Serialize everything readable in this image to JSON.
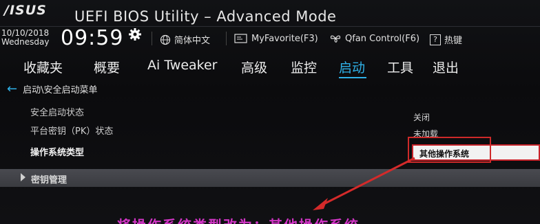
{
  "header": {
    "brand": "/ISUS",
    "title": "UEFI BIOS Utility – Advanced Mode",
    "date": "10/10/2018",
    "weekday": "Wednesday",
    "time": "09:59",
    "language": "简体中文",
    "favorite": "MyFavorite(F3)",
    "qfan": "Qfan Control(F6)",
    "hotkey": "热键"
  },
  "tabs": [
    {
      "label": "收藏夹"
    },
    {
      "label": "概要"
    },
    {
      "label": "Ai Tweaker"
    },
    {
      "label": "高级"
    },
    {
      "label": "监控"
    },
    {
      "label": "启动"
    },
    {
      "label": "工具"
    },
    {
      "label": "退出"
    }
  ],
  "active_tab": "启动",
  "breadcrumb": "启动\\安全启动菜单",
  "settings": [
    {
      "label": "安全启动状态",
      "value": "关闭"
    },
    {
      "label": "平台密钥（PK）状态",
      "value": "未加载"
    },
    {
      "label": "操作系统类型",
      "value": "其他操作系统"
    }
  ],
  "submenu": {
    "label": "密钥管理"
  },
  "annotation": "将操作系统类型改为：其他操作系统",
  "colors": {
    "accent": "#2fb1e8",
    "highlight": "#cf2a2a",
    "annotation": "#d235c6"
  }
}
